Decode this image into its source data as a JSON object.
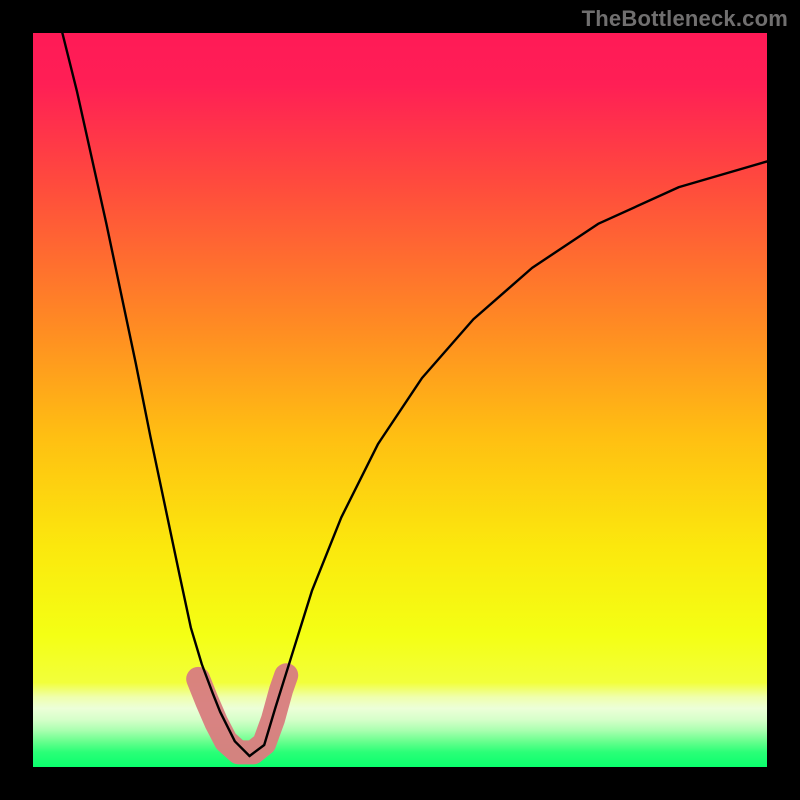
{
  "watermark": "TheBottleneck.com",
  "chart_data": {
    "type": "line",
    "title": "",
    "xlabel": "",
    "ylabel": "",
    "xlim": [
      0,
      100
    ],
    "ylim": [
      0,
      100
    ],
    "grid": false,
    "legend": false,
    "background_gradient": {
      "direction": "top-to-bottom",
      "stops": [
        {
          "pos": 0.0,
          "color": "#ff1a56"
        },
        {
          "pos": 0.07,
          "color": "#ff1f55"
        },
        {
          "pos": 0.2,
          "color": "#ff493e"
        },
        {
          "pos": 0.4,
          "color": "#ff8b23"
        },
        {
          "pos": 0.55,
          "color": "#ffbf12"
        },
        {
          "pos": 0.7,
          "color": "#fbe80d"
        },
        {
          "pos": 0.82,
          "color": "#f4ff14"
        },
        {
          "pos": 0.885,
          "color": "#f2ff3b"
        },
        {
          "pos": 0.905,
          "color": "#efffae"
        },
        {
          "pos": 0.92,
          "color": "#ecffd8"
        },
        {
          "pos": 0.935,
          "color": "#d7ffca"
        },
        {
          "pos": 0.95,
          "color": "#aaffb0"
        },
        {
          "pos": 0.965,
          "color": "#69ff8e"
        },
        {
          "pos": 0.98,
          "color": "#2aff77"
        },
        {
          "pos": 1.0,
          "color": "#0aff6d"
        }
      ]
    },
    "series": [
      {
        "name": "left-branch",
        "x": [
          4.0,
          6.0,
          8.0,
          10.0,
          12.0,
          14.0,
          16.0,
          18.0,
          20.0,
          21.5,
          23.0,
          24.5,
          25.5,
          27.5,
          29.5
        ],
        "y": [
          100.0,
          92.0,
          83.0,
          74.0,
          64.5,
          55.0,
          45.0,
          35.5,
          26.0,
          19.0,
          14.0,
          10.0,
          7.5,
          3.5,
          1.5
        ]
      },
      {
        "name": "right-branch",
        "x": [
          29.5,
          31.5,
          33.0,
          35.5,
          38.0,
          42.0,
          47.0,
          53.0,
          60.0,
          68.0,
          77.0,
          88.0,
          100.0
        ],
        "y": [
          1.5,
          3.0,
          8.0,
          16.0,
          24.0,
          34.0,
          44.0,
          53.0,
          61.0,
          68.0,
          74.0,
          79.0,
          82.5
        ]
      }
    ],
    "markers": {
      "name": "bottleneck-region",
      "color": "#d98080",
      "points": [
        {
          "cx": 22.5,
          "cy": 12.0,
          "r": 1.8
        },
        {
          "cx": 23.7,
          "cy": 9.0,
          "r": 1.8
        },
        {
          "cx": 25.0,
          "cy": 6.0,
          "r": 1.9
        },
        {
          "cx": 26.3,
          "cy": 3.5,
          "r": 1.9
        },
        {
          "cx": 28.0,
          "cy": 2.0,
          "r": 1.9
        },
        {
          "cx": 30.0,
          "cy": 2.0,
          "r": 1.9
        },
        {
          "cx": 31.5,
          "cy": 3.2,
          "r": 1.9
        },
        {
          "cx": 32.7,
          "cy": 6.5,
          "r": 1.9
        },
        {
          "cx": 33.8,
          "cy": 10.5,
          "r": 1.9
        },
        {
          "cx": 34.5,
          "cy": 12.5,
          "r": 1.9
        }
      ]
    }
  }
}
